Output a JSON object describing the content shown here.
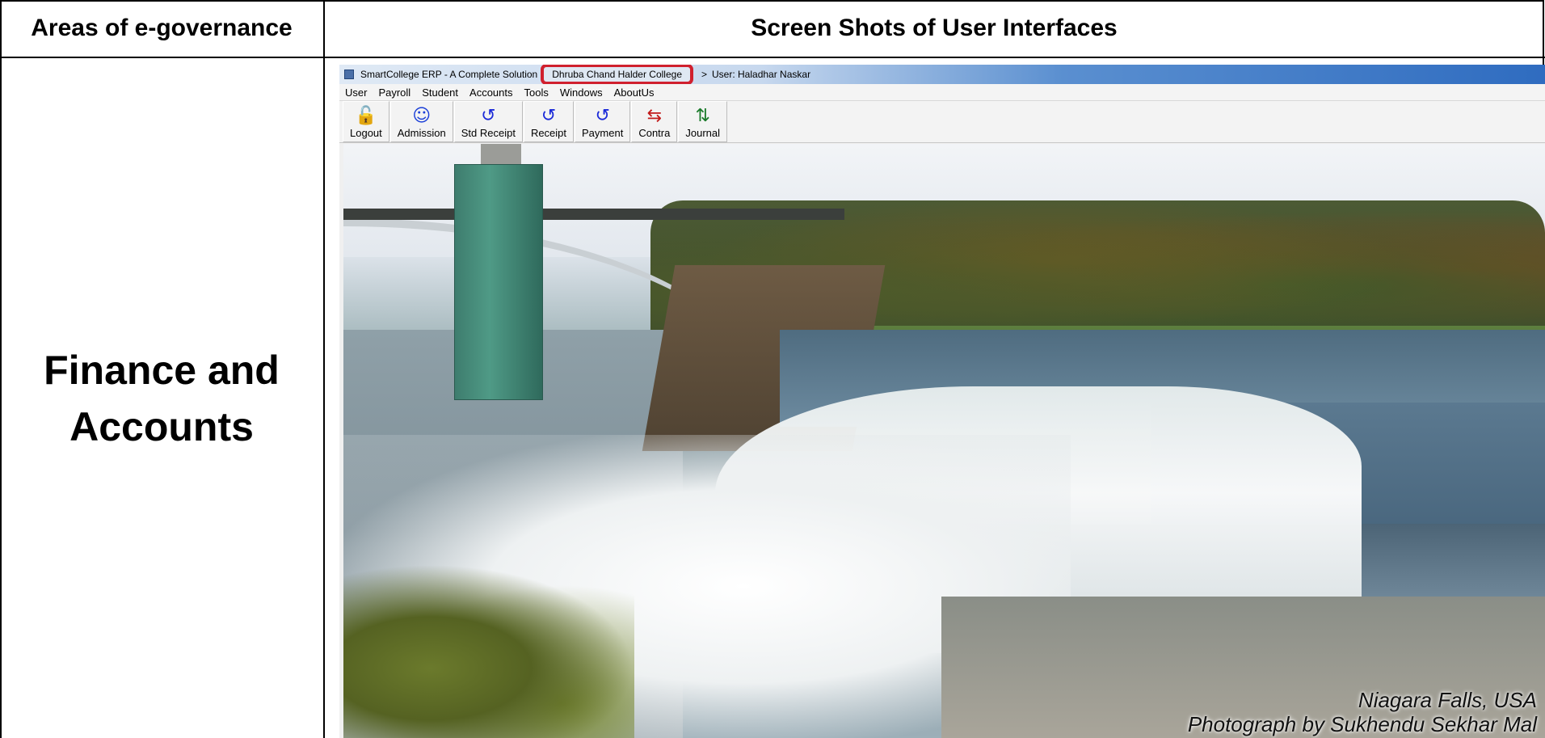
{
  "table": {
    "header_left": "Areas of e-governance",
    "header_right": "Screen Shots of User Interfaces",
    "area": "Finance and Accounts"
  },
  "app": {
    "title_app": "SmartCollege ERP - A Complete Solution",
    "title_college": "Dhruba Chand Halder College",
    "title_sep": ">",
    "title_user": "User: Haladhar Naskar",
    "highlight_color": "#d0202e"
  },
  "menu": [
    "User",
    "Payroll",
    "Student",
    "Accounts",
    "Tools",
    "Windows",
    "AboutUs"
  ],
  "toolbar": [
    {
      "label": "Logout",
      "icon": "logout-icon",
      "glyph": "🔓",
      "color": "#d81b1b"
    },
    {
      "label": "Admission",
      "icon": "smiley-icon",
      "glyph": "☺",
      "color": "#1b3fd8"
    },
    {
      "label": "Std Receipt",
      "icon": "std-receipt-icon",
      "glyph": "↺",
      "color": "#1b2ad8"
    },
    {
      "label": "Receipt",
      "icon": "receipt-icon",
      "glyph": "↺",
      "color": "#1b2ad8"
    },
    {
      "label": "Payment",
      "icon": "payment-icon",
      "glyph": "↺",
      "color": "#1b2ad8"
    },
    {
      "label": "Contra",
      "icon": "contra-icon",
      "glyph": "⇆",
      "color": "#c21b1b"
    },
    {
      "label": "Journal",
      "icon": "journal-icon",
      "glyph": "⇅",
      "color": "#1a7a2a"
    }
  ],
  "photo": {
    "caption_line1": "Niagara Falls, USA",
    "caption_line2": "Photograph by Sukhendu Sekhar Mal"
  }
}
